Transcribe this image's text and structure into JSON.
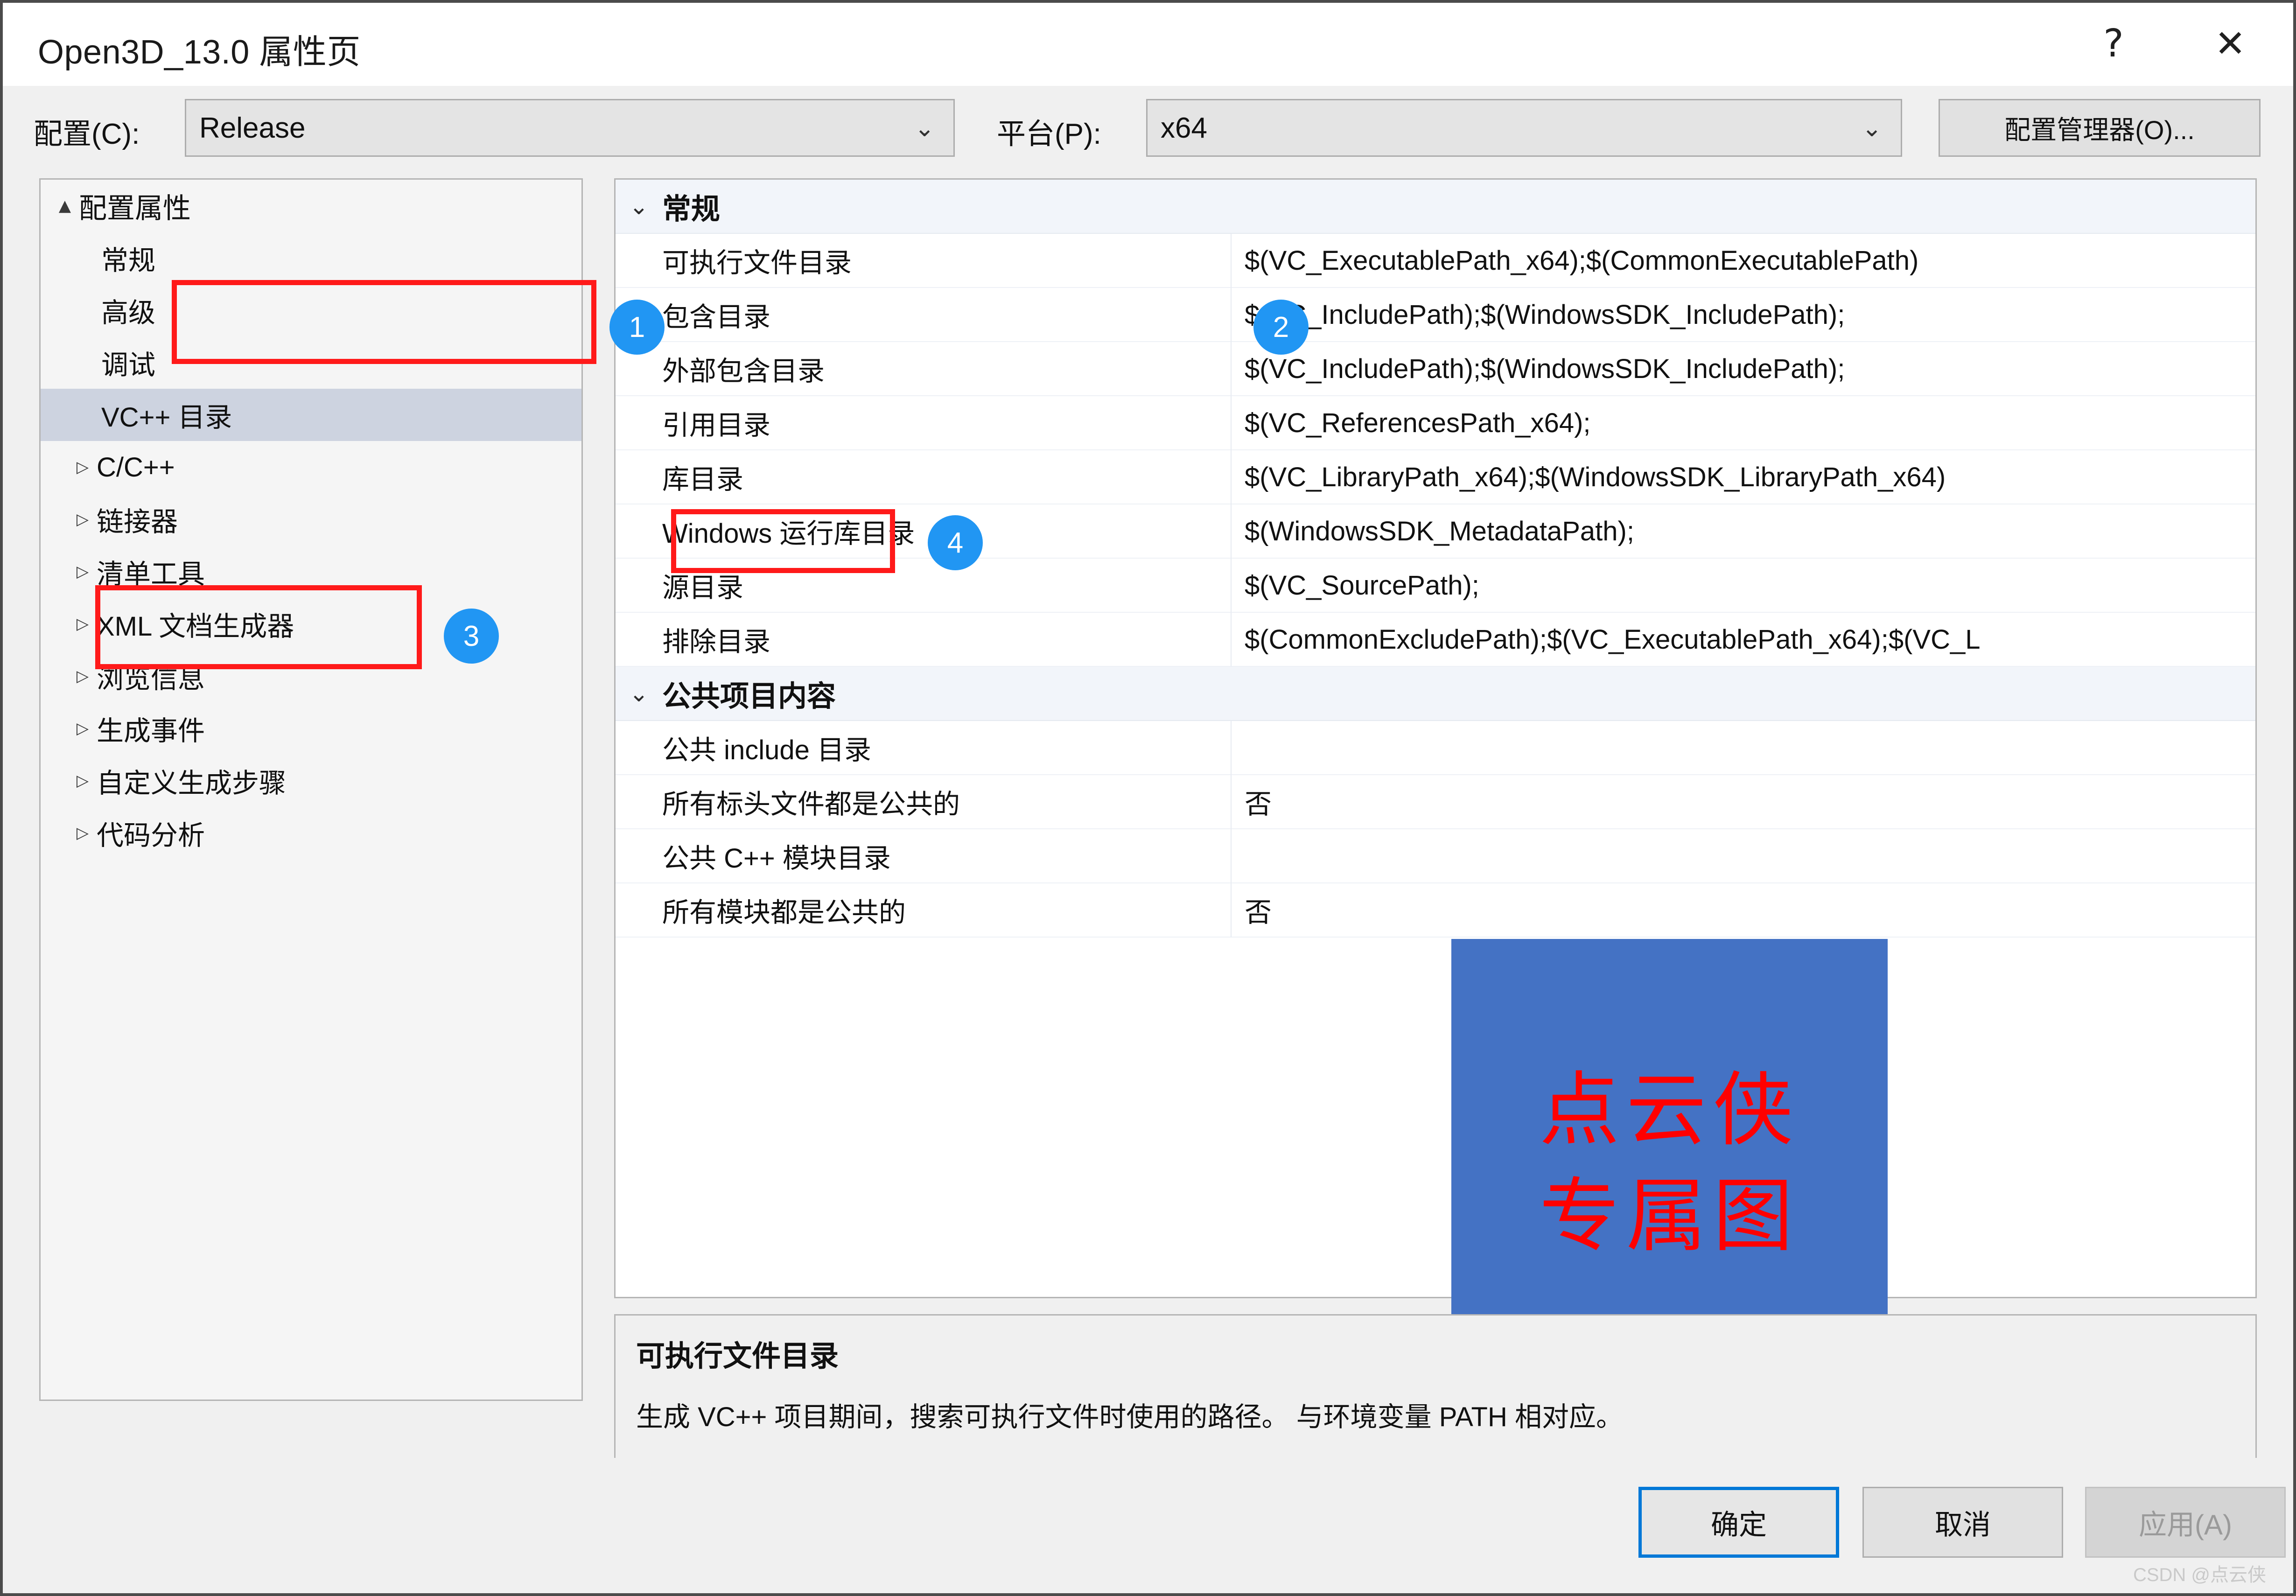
{
  "window": {
    "title": "Open3D_13.0 属性页",
    "help_icon": "?",
    "close_icon": "✕"
  },
  "configbar": {
    "config_label": "配置(C):",
    "config_value": "Release",
    "platform_label": "平台(P):",
    "platform_value": "x64",
    "config_manager_button": "配置管理器(O)...",
    "dropdown_chevron": "⌄"
  },
  "tree": {
    "items": [
      {
        "label": "配置属性",
        "level": 0,
        "twisty": "▲",
        "selected": false
      },
      {
        "label": "常规",
        "level": 1,
        "twisty": "",
        "selected": false
      },
      {
        "label": "高级",
        "level": 1,
        "twisty": "",
        "selected": false
      },
      {
        "label": "调试",
        "level": 1,
        "twisty": "",
        "selected": false
      },
      {
        "label": "VC++ 目录",
        "level": 1,
        "twisty": "",
        "selected": true
      },
      {
        "label": "C/C++",
        "level": 1,
        "twisty": "▷",
        "selected": false
      },
      {
        "label": "链接器",
        "level": 1,
        "twisty": "▷",
        "selected": false
      },
      {
        "label": "清单工具",
        "level": 1,
        "twisty": "▷",
        "selected": false
      },
      {
        "label": "XML 文档生成器",
        "level": 1,
        "twisty": "▷",
        "selected": false
      },
      {
        "label": "浏览信息",
        "level": 1,
        "twisty": "▷",
        "selected": false
      },
      {
        "label": "生成事件",
        "level": 1,
        "twisty": "▷",
        "selected": false
      },
      {
        "label": "自定义生成步骤",
        "level": 1,
        "twisty": "▷",
        "selected": false
      },
      {
        "label": "代码分析",
        "level": 1,
        "twisty": "▷",
        "selected": false
      }
    ]
  },
  "grid": {
    "rows": [
      {
        "type": "category",
        "chevron": "⌄",
        "name": "常规",
        "value": ""
      },
      {
        "type": "prop",
        "name": "可执行文件目录",
        "value": "$(VC_ExecutablePath_x64);$(CommonExecutablePath)"
      },
      {
        "type": "prop",
        "name": "包含目录",
        "value": "$(VC_IncludePath);$(WindowsSDK_IncludePath);"
      },
      {
        "type": "prop",
        "name": "外部包含目录",
        "value": "$(VC_IncludePath);$(WindowsSDK_IncludePath);"
      },
      {
        "type": "prop",
        "name": "引用目录",
        "value": "$(VC_ReferencesPath_x64);"
      },
      {
        "type": "prop",
        "name": "库目录",
        "value": "$(VC_LibraryPath_x64);$(WindowsSDK_LibraryPath_x64)"
      },
      {
        "type": "prop",
        "name": "Windows 运行库目录",
        "value": "$(WindowsSDK_MetadataPath);"
      },
      {
        "type": "prop",
        "name": "源目录",
        "value": "$(VC_SourcePath);"
      },
      {
        "type": "prop",
        "name": "排除目录",
        "value": "$(CommonExcludePath);$(VC_ExecutablePath_x64);$(VC_L"
      },
      {
        "type": "category",
        "chevron": "⌄",
        "name": "公共项目内容",
        "value": ""
      },
      {
        "type": "prop",
        "name": "公共 include 目录",
        "value": ""
      },
      {
        "type": "prop",
        "name": "所有标头文件都是公共的",
        "value": "否"
      },
      {
        "type": "prop",
        "name": "公共 C++ 模块目录",
        "value": ""
      },
      {
        "type": "prop",
        "name": "所有模块都是公共的",
        "value": "否"
      }
    ]
  },
  "description": {
    "title": "可执行文件目录",
    "text": "生成 VC++ 项目期间，搜索可执行文件时使用的路径。  与环境变量 PATH 相对应。"
  },
  "footer": {
    "ok": "确定",
    "cancel": "取消",
    "apply": "应用(A)"
  },
  "annotations": {
    "badge_1": "1",
    "badge_2": "2",
    "badge_3": "3",
    "badge_4": "4",
    "highlight_color": "#ff1a1a",
    "badge_color": "#2196f3"
  },
  "watermark": {
    "line1": "点云侠",
    "line2": "专属图",
    "background_color": "#4472c4",
    "text_color": "#ff0000",
    "corner_credit": "CSDN @点云侠"
  }
}
